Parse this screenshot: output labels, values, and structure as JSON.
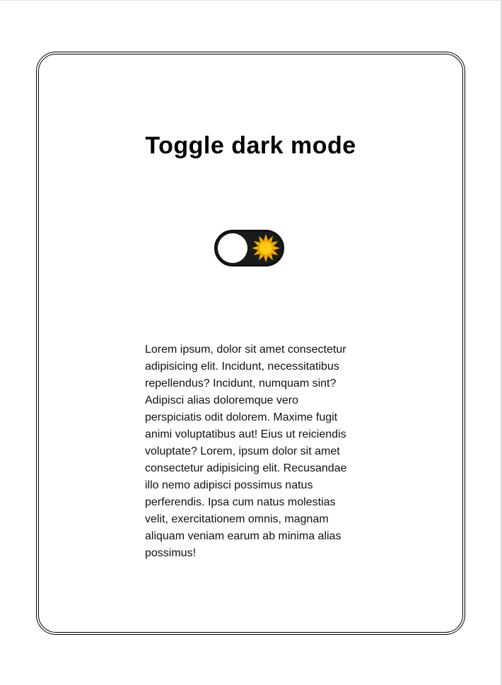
{
  "page": {
    "title": "Toggle dark mode",
    "toggle": {
      "state": "light",
      "icon": "sun-icon",
      "track_color": "#1b1b1b",
      "knob_color": "#ffffff",
      "sun_color": "#f6b800"
    },
    "paragraph": "Lorem ipsum, dolor sit amet consectetur adipisicing elit. Incidunt, necessitatibus repellendus? Incidunt, numquam sint? Adipisci alias doloremque vero perspiciatis odit dolorem. Maxime fugit animi voluptatibus aut! Eius ut reiciendis voluptate? Lorem, ipsum dolor sit amet consectetur adipisicing elit. Recusandae illo nemo adipisci possimus natus perferendis. Ipsa cum natus molestias velit, exercitationem omnis, magnam aliquam veniam earum ab minima alias possimus!"
  }
}
